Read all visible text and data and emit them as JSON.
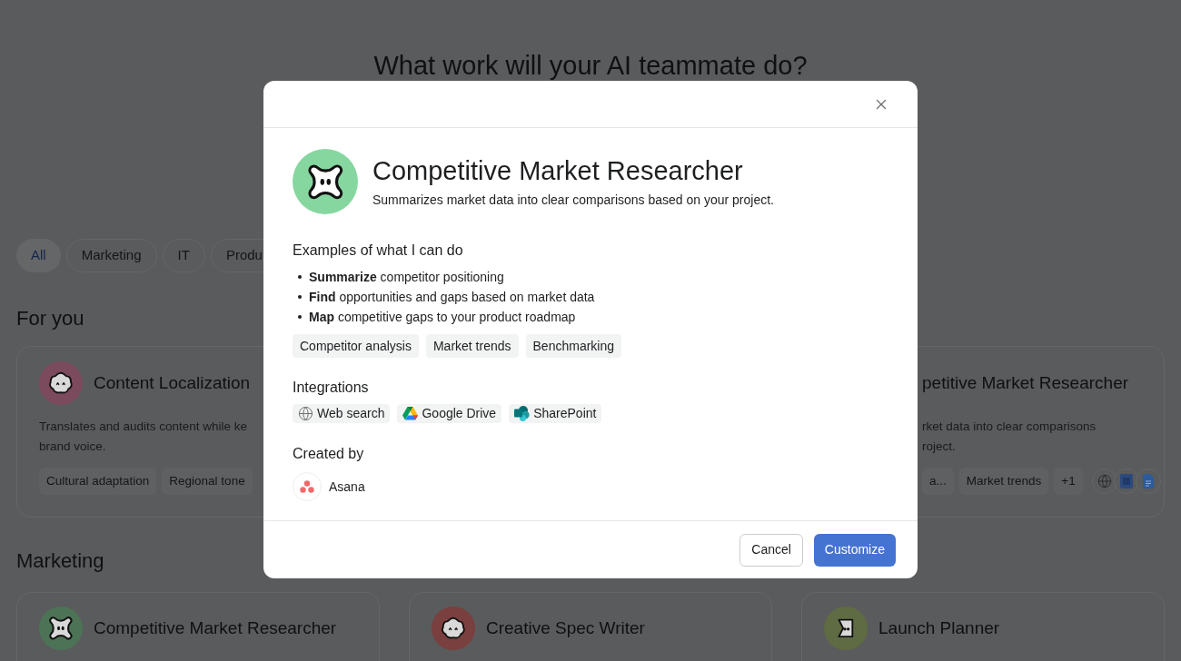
{
  "page": {
    "title": "What work will your AI teammate do?",
    "filters": [
      {
        "label": "All",
        "selected": true
      },
      {
        "label": "Marketing",
        "selected": false
      },
      {
        "label": "IT",
        "selected": false
      },
      {
        "label": "Produ",
        "selected": false
      }
    ],
    "for_you": {
      "heading": "For you",
      "cards": [
        {
          "title": "Content Localization",
          "kind": "flower",
          "color": "#7b4a5c",
          "description_lines": [
            "Translates and audits content while ke",
            "brand voice."
          ],
          "tags": [
            "Cultural adaptation",
            "Regional tone"
          ]
        },
        {
          "title": "petitive Market Researcher",
          "description_lines": [
            "rket data into clear comparisons",
            "roject."
          ],
          "tags": [
            "a...",
            "Market trends",
            "+1"
          ],
          "integration_icons": [
            {
              "kind": "globe"
            },
            {
              "kind": "word"
            },
            {
              "kind": "doc"
            }
          ]
        }
      ]
    },
    "marketing": {
      "heading": "Marketing",
      "cards": [
        {
          "title": "Competitive Market Researcher",
          "kind": "cross",
          "color": "#4d7357"
        },
        {
          "title": "Creative Spec Writer",
          "kind": "flower",
          "color": "#7a3f3f"
        },
        {
          "title": "Launch Planner",
          "kind": "bracket",
          "color": "#5f6b43"
        }
      ]
    }
  },
  "dialog": {
    "title": "Competitive Market Researcher",
    "kind": "cross",
    "color": "#86d6a0",
    "subtitle": "Summarizes market data into clear comparisons based on your project.",
    "examples_heading": "Examples of what I can do",
    "examples": [
      "**Summarize** competitor positioning",
      "**Find** opportunities and gaps based on market data",
      "**Map** competitive gaps to your product roadmap"
    ],
    "tags": [
      "Competitor analysis",
      "Market trends",
      "Benchmarking"
    ],
    "integrations_heading": "Integrations",
    "integrations": [
      {
        "label": "Web search",
        "kind": "globe"
      },
      {
        "label": "Google Drive",
        "kind": "drive"
      },
      {
        "label": "SharePoint",
        "kind": "sharepoint"
      }
    ],
    "created_by_heading": "Created by",
    "creator": "Asana",
    "buttons": [
      {
        "label": "Cancel",
        "kind": "secondary"
      },
      {
        "label": "Customize",
        "kind": "primary"
      }
    ]
  }
}
